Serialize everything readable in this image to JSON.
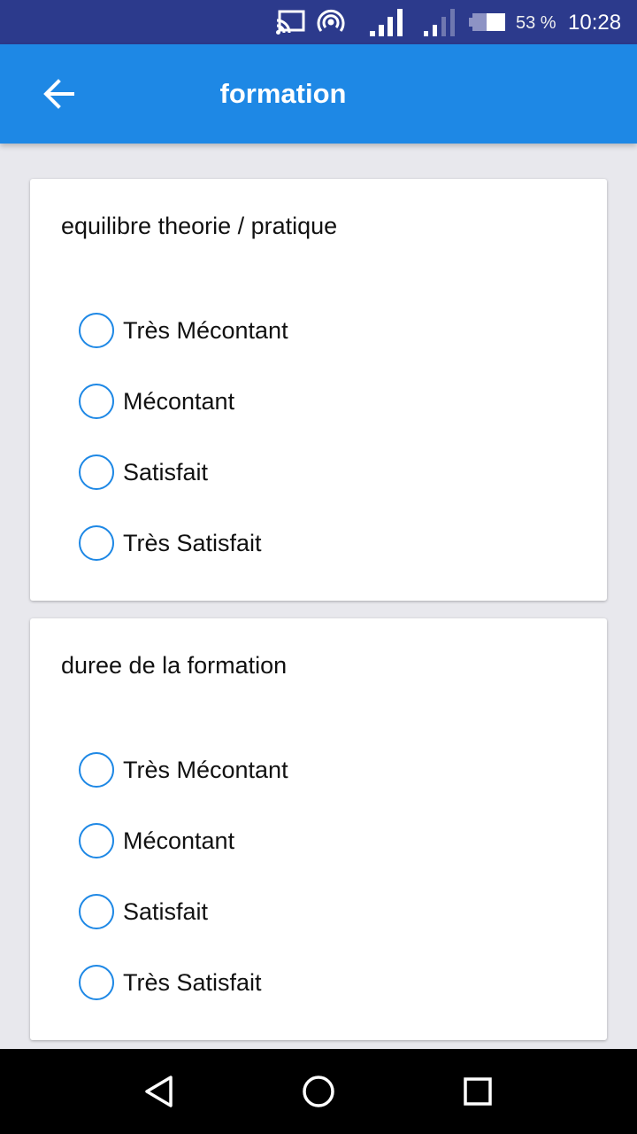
{
  "status_bar": {
    "battery_percent": "53 %",
    "time": "10:28",
    "icons": [
      "cast-icon",
      "hotspot-icon",
      "signal-icon",
      "signal-icon",
      "battery-icon"
    ]
  },
  "app_bar": {
    "title": "formation",
    "back_icon": "arrow-back-icon"
  },
  "questions": [
    {
      "label": "equilibre theorie / pratique",
      "options": [
        "Très Mécontant",
        "Mécontant",
        "Satisfait",
        "Très Satisfait"
      ],
      "selected": null
    },
    {
      "label": "duree de la formation",
      "options": [
        "Très Mécontant",
        "Mécontant",
        "Satisfait",
        "Très Satisfait"
      ],
      "selected": null
    }
  ],
  "nav_bar": {
    "icons": [
      "nav-back-icon",
      "nav-home-icon",
      "nav-recent-icon"
    ]
  },
  "colors": {
    "status_bar": "#2c3a8c",
    "app_bar": "#1e88e5",
    "radio_accent": "#1e88e5",
    "background": "#e8e8ed"
  }
}
